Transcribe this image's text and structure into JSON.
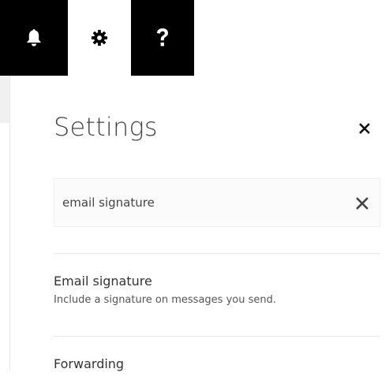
{
  "toolbar": {
    "buttons": [
      {
        "icon": "bell-icon"
      },
      {
        "icon": "gear-icon",
        "selected": true
      },
      {
        "icon": "help-icon",
        "glyph": "?"
      }
    ],
    "background_color": "#000000",
    "selected_color": "#ffffff"
  },
  "panel": {
    "title": "Settings",
    "close_icon": "close-icon"
  },
  "search": {
    "value": "email signature",
    "clear_icon": "close-icon"
  },
  "results": [
    {
      "title": "Email signature",
      "description": "Include a signature on messages you send."
    },
    {
      "title": "Forwarding"
    }
  ]
}
